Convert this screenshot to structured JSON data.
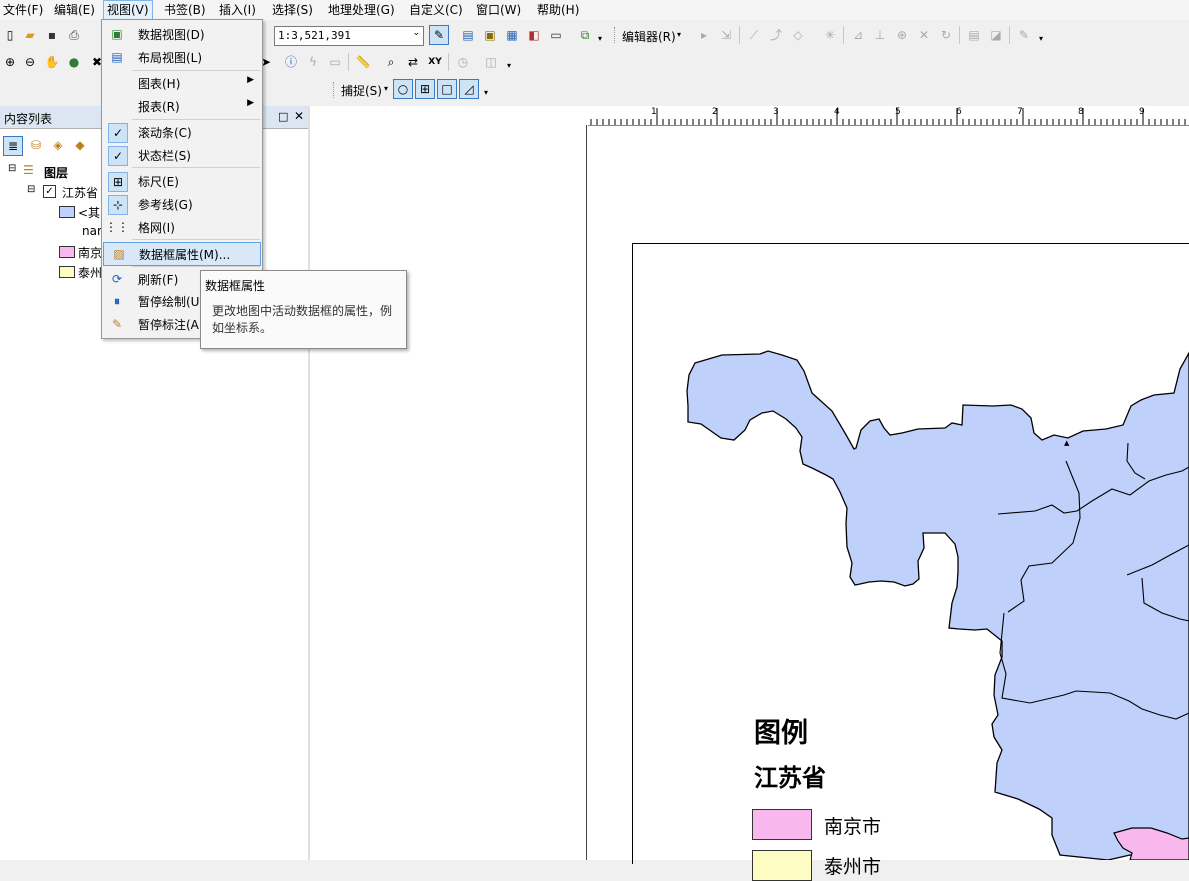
{
  "menubar": {
    "items": [
      "文件(F)",
      "编辑(E)",
      "视图(V)",
      "书签(B)",
      "插入(I)",
      "选择(S)",
      "地理处理(G)",
      "自定义(C)",
      "窗口(W)",
      "帮助(H)"
    ]
  },
  "toolbar": {
    "scale_value": "1:3,521,391",
    "editor_label": "编辑器(R)",
    "snapping_label": "捕捉(S)"
  },
  "toc": {
    "title": "内容列表",
    "layers_label": "图层",
    "layer_name": "江苏省",
    "class_other": "<其",
    "field_name": "nar",
    "class_nanjing": "南京",
    "class_taizhou": "泰州"
  },
  "view_menu": {
    "items": [
      {
        "label": "数据视图(D)",
        "icon": "data-view-icon"
      },
      {
        "label": "布局视图(L)",
        "icon": "layout-view-icon"
      },
      {
        "label": "图表(H)",
        "submenu": true
      },
      {
        "label": "报表(R)",
        "submenu": true
      },
      {
        "label": "滚动条(C)",
        "checked": true
      },
      {
        "label": "状态栏(S)",
        "checked": true
      },
      {
        "label": "标尺(E)",
        "icon": "ruler-icon"
      },
      {
        "label": "参考线(G)",
        "icon": "guides-icon"
      },
      {
        "label": "格网(I)",
        "icon": "grid-icon"
      },
      {
        "label": "数据框属性(M)...",
        "icon": "data-frame-properties-icon",
        "highlighted": true
      },
      {
        "label": "刷新(F)",
        "icon": "refresh-icon"
      },
      {
        "label": "暂停绘制(U",
        "icon": "pause-drawing-icon"
      },
      {
        "label": "暂停标注(A",
        "icon": "pause-labeling-icon"
      }
    ]
  },
  "tooltip": {
    "title": "数据框属性",
    "body": "更改地图中活动数据框的属性，例如坐标系。"
  },
  "ruler": {
    "labels": [
      "1",
      "2",
      "3",
      "4",
      "5",
      "6",
      "7",
      "8",
      "9"
    ]
  },
  "map": {
    "legend_title": "图例",
    "legend_layer": "江苏省",
    "legend_item_1": "南京市",
    "legend_item_2": "泰州市",
    "colors": {
      "other": "#bfd1fa",
      "nanjing": "#f8b8ee",
      "taizhou": "#fdfcc2"
    }
  }
}
